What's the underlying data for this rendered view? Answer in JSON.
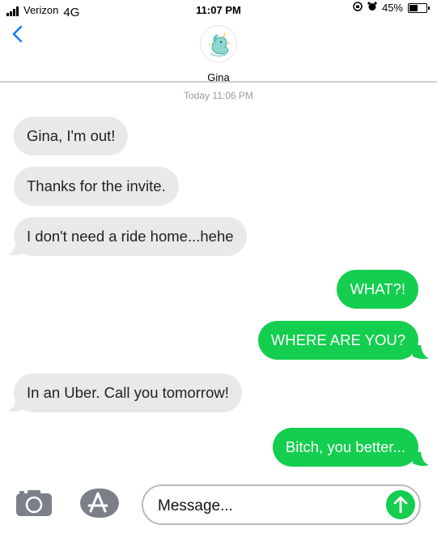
{
  "status_bar": {
    "carrier": "Verizon",
    "network": "4G",
    "time": "11:07 PM",
    "battery_percent": "45%",
    "battery_level": 0.45,
    "icons": [
      "signal-icon",
      "rotation-lock-icon",
      "alarm-icon",
      "battery-icon"
    ]
  },
  "header": {
    "back_icon": "chevron-left-icon",
    "contact_name": "Gina",
    "avatar_icon": "unicorn-avatar"
  },
  "thread": {
    "timestamp": "Today 11:06 PM",
    "messages": [
      {
        "direction": "received",
        "text": "Gina, I'm out!"
      },
      {
        "direction": "received",
        "text": "Thanks for the invite."
      },
      {
        "direction": "received",
        "text": "I don't need a ride home...hehe"
      },
      {
        "direction": "sent",
        "text": "WHAT?!"
      },
      {
        "direction": "sent",
        "text": "WHERE ARE YOU?"
      },
      {
        "direction": "received",
        "text": "In an Uber. Call you tomorrow!"
      },
      {
        "direction": "sent",
        "text": "Bitch, you better..."
      }
    ]
  },
  "composer": {
    "placeholder": "Message...",
    "camera_icon": "camera-icon",
    "apps_icon": "app-store-icon",
    "send_icon": "arrow-up-icon"
  },
  "colors": {
    "sent_bubble": "#14ce4f",
    "received_bubble": "#e9e9eb",
    "accent": "#147efb"
  }
}
